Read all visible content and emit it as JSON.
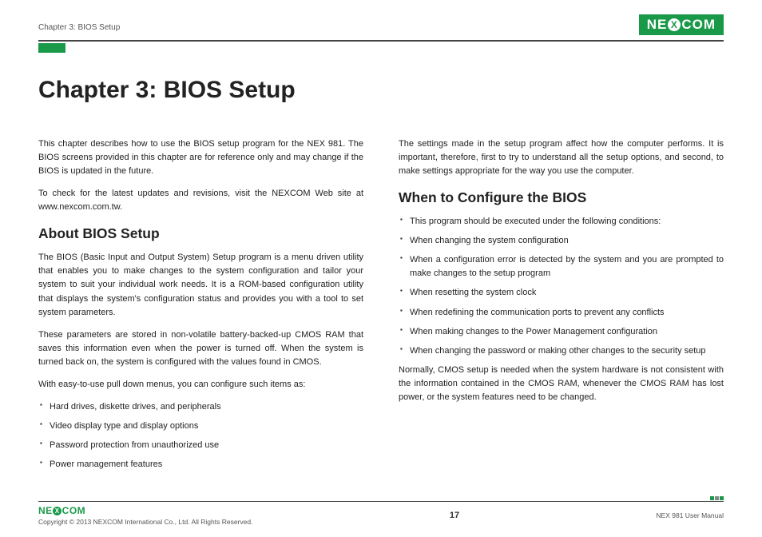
{
  "header": {
    "chapter_ref": "Chapter 3: BIOS Setup",
    "brand_pre": "NE",
    "brand_x": "X",
    "brand_post": "COM"
  },
  "title": "Chapter 3: BIOS Setup",
  "left": {
    "intro1": "This chapter describes how to use the BIOS setup program for the NEX 981. The BIOS screens provided in this chapter are for reference only and may change if the BIOS is updated in the future.",
    "intro2": "To check for the latest updates and revisions, visit the NEXCOM Web site at www.nexcom.com.tw.",
    "h2": "About BIOS Setup",
    "p1": "The BIOS (Basic Input and Output System) Setup program is a menu driven utility that enables you to make changes to the system configuration and tailor your system to suit your individual work needs. It is a ROM-based configuration utility that displays the system's configuration status and provides you with a tool to set system parameters.",
    "p2": "These parameters are stored in non-volatile battery-backed-up CMOS RAM that saves this information even when the power is turned off. When the system is turned back on, the system is configured with the values found in CMOS.",
    "p3": "With easy-to-use pull down menus, you can configure such items as:",
    "items": [
      "Hard drives, diskette drives, and peripherals",
      "Video display type and display options",
      "Password protection from unauthorized use",
      "Power management features"
    ]
  },
  "right": {
    "intro": "The settings made in the setup program affect how the computer performs. It is important, therefore, first to try to understand all the setup options, and second, to make settings appropriate for the way you use the computer.",
    "h2": "When to Configure the BIOS",
    "items": [
      "This program should be executed under the following conditions:",
      "When changing the system configuration",
      "When a configuration error is detected by the system and you are prompted to make changes to the setup program",
      "When resetting the system clock",
      "When redefining the communication ports to prevent any conflicts",
      "When making changes to the Power Management configuration",
      "When changing the password or making other changes to the security setup"
    ],
    "outro": "Normally, CMOS setup is needed when the system hardware is not consistent with the information contained in the CMOS RAM, whenever the CMOS RAM has lost power, or the system features need to be changed."
  },
  "footer": {
    "copyright": "Copyright © 2013 NEXCOM International Co., Ltd. All Rights Reserved.",
    "page": "17",
    "manual": "NEX 981 User Manual"
  }
}
